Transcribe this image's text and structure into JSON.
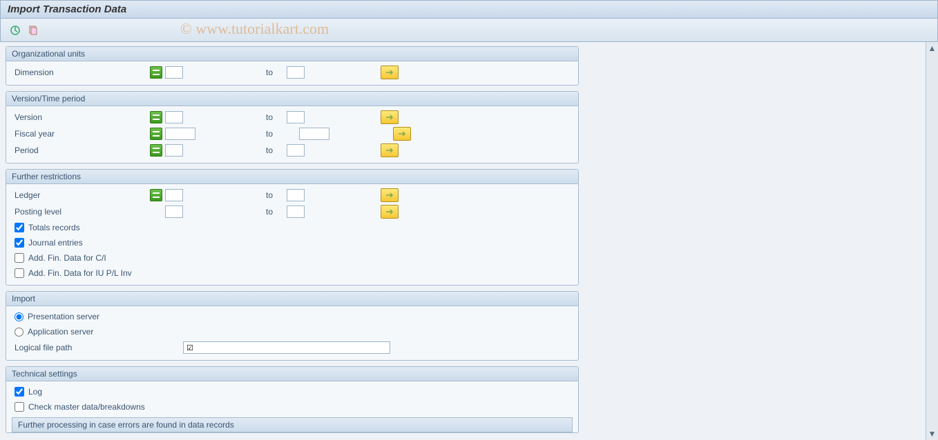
{
  "title": "Import Transaction Data",
  "watermark": "© www.tutorialkart.com",
  "groups": {
    "org": {
      "title": "Organizational units",
      "dimension_label": "Dimension",
      "to": "to"
    },
    "version": {
      "title": "Version/Time period",
      "version_label": "Version",
      "fiscal_year_label": "Fiscal year",
      "period_label": "Period",
      "to": "to"
    },
    "further": {
      "title": "Further restrictions",
      "ledger_label": "Ledger",
      "posting_level_label": "Posting level",
      "to": "to",
      "totals_records": "Totals records",
      "journal_entries": "Journal entries",
      "add_fin_ci": "Add. Fin. Data for C/I",
      "add_fin_iu": "Add. Fin. Data for IU P/L Inv"
    },
    "import": {
      "title": "Import",
      "presentation_server": "Presentation server",
      "application_server": "Application server",
      "logical_file_path": "Logical file path",
      "file_value": "☑"
    },
    "technical": {
      "title": "Technical settings",
      "log": "Log",
      "check_master": "Check master data/breakdowns",
      "further_processing": "Further processing in case errors are found in data records"
    }
  }
}
